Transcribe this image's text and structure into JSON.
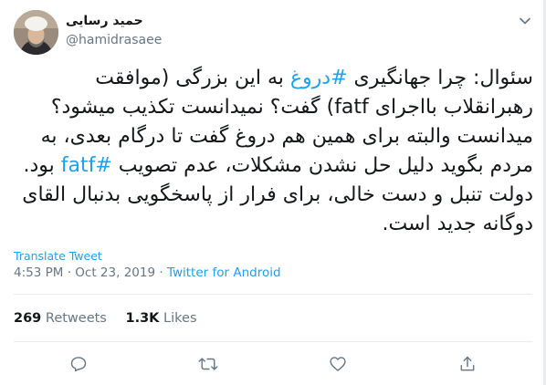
{
  "author": {
    "display_name": "حمید رسایی",
    "handle": "@hamidrasaee"
  },
  "tweet": {
    "segments": [
      {
        "text": "سئوال: چرا جهانگیری ",
        "hashtag": false
      },
      {
        "text": "#دروغ",
        "hashtag": true
      },
      {
        "text": " به این بزرگی (موافقت رهبرانقلاب بااجرای fatf) گفت؟ نمیدانست تکذیب میشود؟ میدانست والبته برای همین هم دروغ گفت تا درگام بعدی، به مردم بگوید دلیل حل نشدن مشکلات، عدم تصویب ",
        "hashtag": false
      },
      {
        "text": "#fatf",
        "hashtag": true
      },
      {
        "text": " بود. دولت تنبل و دست خالی، برای فرار از پاسخگویی بدنبال القای دوگانه جدید است.",
        "hashtag": false
      }
    ],
    "translate_label": "Translate Tweet",
    "time": "4:53 PM",
    "date": "Oct 23, 2019",
    "separator": "·",
    "source": "Twitter for Android"
  },
  "stats": {
    "retweets_count": "269",
    "retweets_label": "Retweets",
    "likes_count": "1.3K",
    "likes_label": "Likes"
  },
  "icons": {
    "more": "chevron-down-icon",
    "reply": "reply-icon",
    "retweet": "retweet-icon",
    "like": "heart-icon",
    "share": "share-icon"
  },
  "colors": {
    "accent": "#1da1f2",
    "text": "#14171a",
    "muted": "#657786",
    "border": "#e6ecf0"
  }
}
